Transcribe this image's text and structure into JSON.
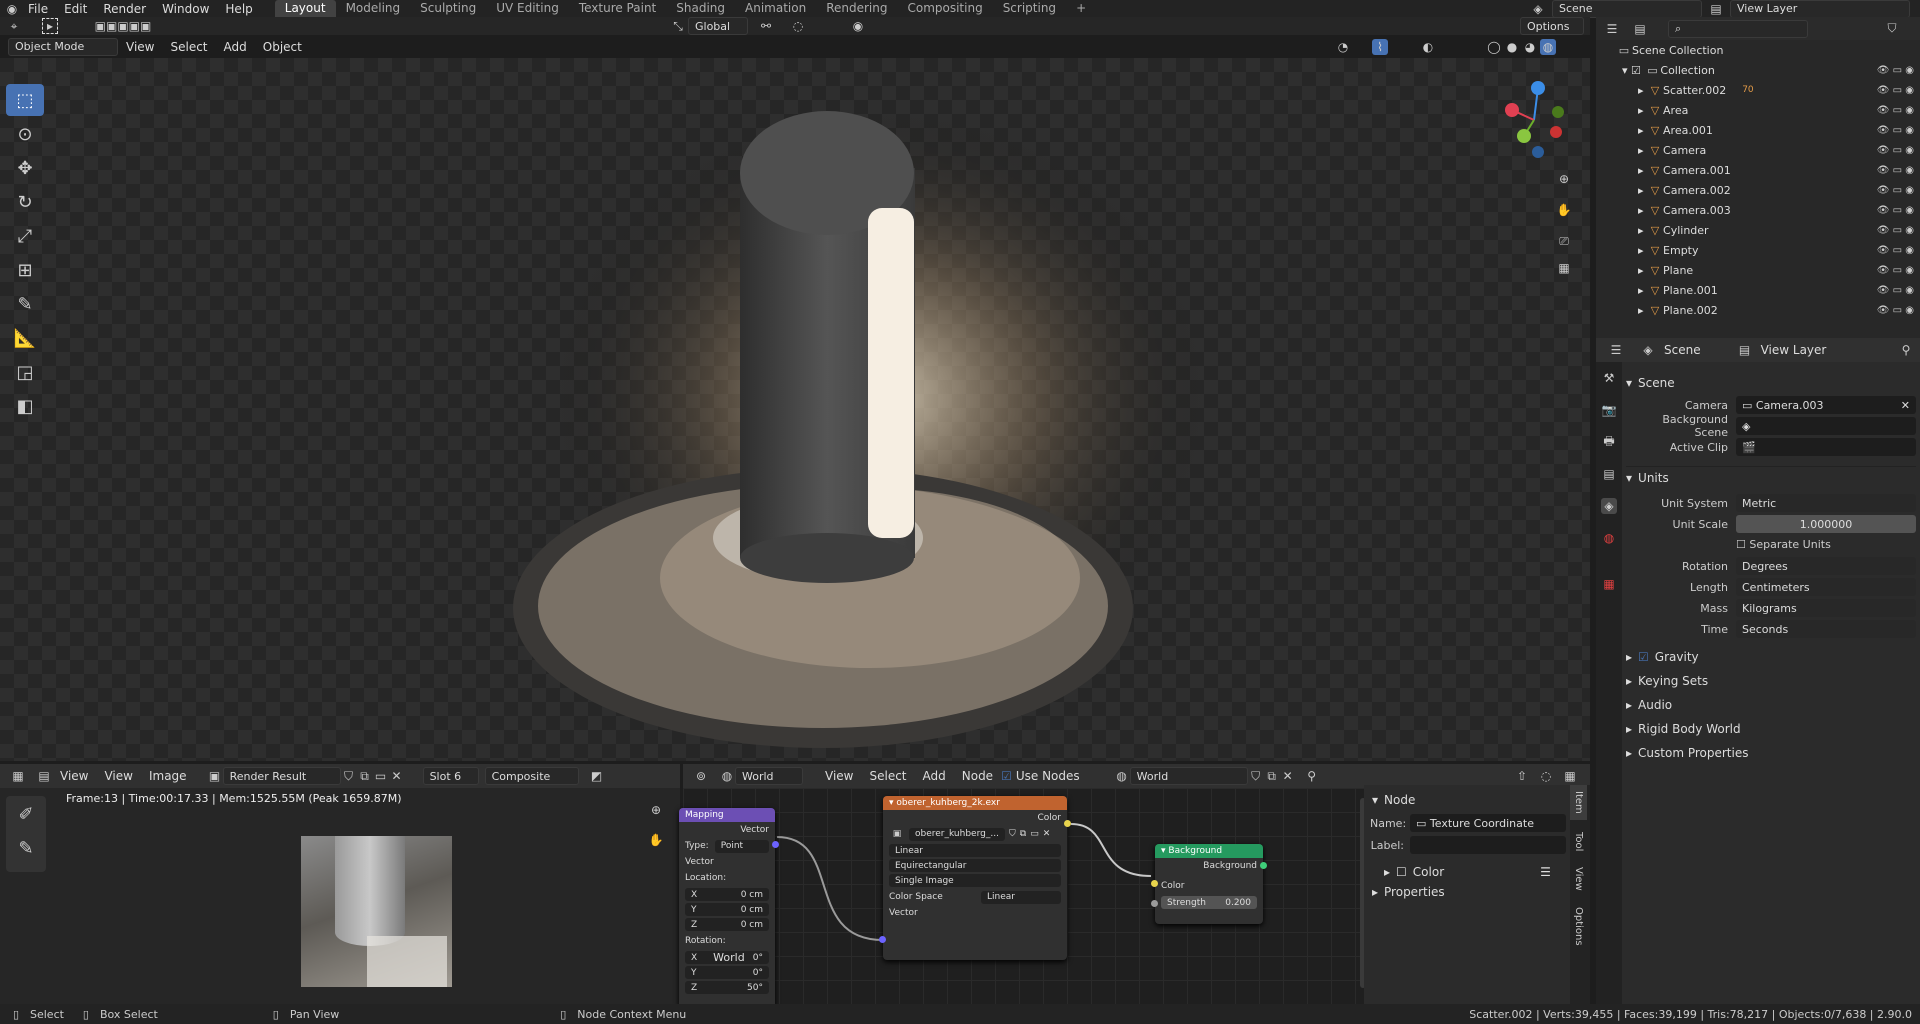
{
  "menus": [
    "File",
    "Edit",
    "Render",
    "Window",
    "Help"
  ],
  "workspaces": [
    "Layout",
    "Modeling",
    "Sculpting",
    "UV Editing",
    "Texture Paint",
    "Shading",
    "Animation",
    "Rendering",
    "Compositing",
    "Scripting"
  ],
  "active_workspace": "Layout",
  "scene_name": "Scene",
  "view_layer": "View Layer",
  "viewport": {
    "mode": "Object Mode",
    "menus": [
      "View",
      "Select",
      "Add",
      "Object"
    ],
    "transform": "Global",
    "options": "Options"
  },
  "outliner": {
    "root": "Scene Collection",
    "collection": "Collection",
    "items": [
      {
        "name": "Scatter.002",
        "badge": "70"
      },
      {
        "name": "Area"
      },
      {
        "name": "Area.001"
      },
      {
        "name": "Camera"
      },
      {
        "name": "Camera.001"
      },
      {
        "name": "Camera.002"
      },
      {
        "name": "Camera.003"
      },
      {
        "name": "Cylinder"
      },
      {
        "name": "Empty"
      },
      {
        "name": "Plane"
      },
      {
        "name": "Plane.001"
      },
      {
        "name": "Plane.002"
      }
    ]
  },
  "props": {
    "tab_scene": "Scene",
    "tab_layer": "View Layer",
    "scene_section": "Scene",
    "camera_label": "Camera",
    "camera_value": "Camera.003",
    "bg_label": "Background Scene",
    "clip_label": "Active Clip",
    "units_section": "Units",
    "unit_system_label": "Unit System",
    "unit_system": "Metric",
    "unit_scale_label": "Unit Scale",
    "unit_scale": "1.000000",
    "separate_units": "Separate Units",
    "rotation_label": "Rotation",
    "rotation": "Degrees",
    "length_label": "Length",
    "length": "Centimeters",
    "mass_label": "Mass",
    "mass": "Kilograms",
    "time_label": "Time",
    "time": "Seconds",
    "gravity": "Gravity",
    "keying": "Keying Sets",
    "audio": "Audio",
    "rigid": "Rigid Body World",
    "custom": "Custom Properties"
  },
  "image_editor": {
    "view": "View",
    "menus": [
      "View",
      "Image"
    ],
    "image": "Render Result",
    "slot": "Slot 6",
    "layer": "Composite",
    "info": "Frame:13 | Time:00:17.33 | Mem:1525.55M (Peak 1659.87M)"
  },
  "node_editor": {
    "type": "World",
    "menus": [
      "View",
      "Select",
      "Add",
      "Node"
    ],
    "use_nodes": "Use Nodes",
    "world": "World",
    "mapping": {
      "title": "Mapping",
      "out": "Vector",
      "type_label": "Type:",
      "type": "Point",
      "vector": "Vector",
      "location": "Location:",
      "x": "X",
      "y": "Y",
      "z": "Z",
      "lx": "0 cm",
      "ly": "0 cm",
      "lz": "0 cm",
      "rotation": "Rotation:",
      "rx": "0°",
      "ry": "0°",
      "rz": "50°",
      "tooltip": "World"
    },
    "env": {
      "title": "oberer_kuhberg_2k.exr",
      "color": "Color",
      "file": "oberer_kuhberg_...",
      "interp": "Linear",
      "proj": "Equirectangular",
      "src": "Single Image",
      "cs_label": "Color Space",
      "cs": "Linear",
      "vector": "Vector"
    },
    "bg": {
      "title": "Background",
      "out": "Background",
      "color": "Color",
      "strength_label": "Strength",
      "strength": "0.200"
    }
  },
  "node_panel": {
    "section": "Node",
    "name_label": "Name:",
    "name": "Texture Coordinate",
    "label_label": "Label:",
    "color": "Color",
    "properties": "Properties",
    "tabs": [
      "Item",
      "Tool",
      "View",
      "Options"
    ]
  },
  "status": {
    "select": "Select",
    "box": "Box Select",
    "pan": "Pan View",
    "ctx": "Node Context Menu",
    "stats": "Scatter.002 | Verts:39,455 | Faces:39,199 | Tris:78,217 | Objects:0/7,638 | 2.90.0"
  },
  "colors": {
    "accent": "#4772b3",
    "mapping_header": "#6c4fb4",
    "texture_header": "#c0632f",
    "bg_header": "#259a5f"
  }
}
